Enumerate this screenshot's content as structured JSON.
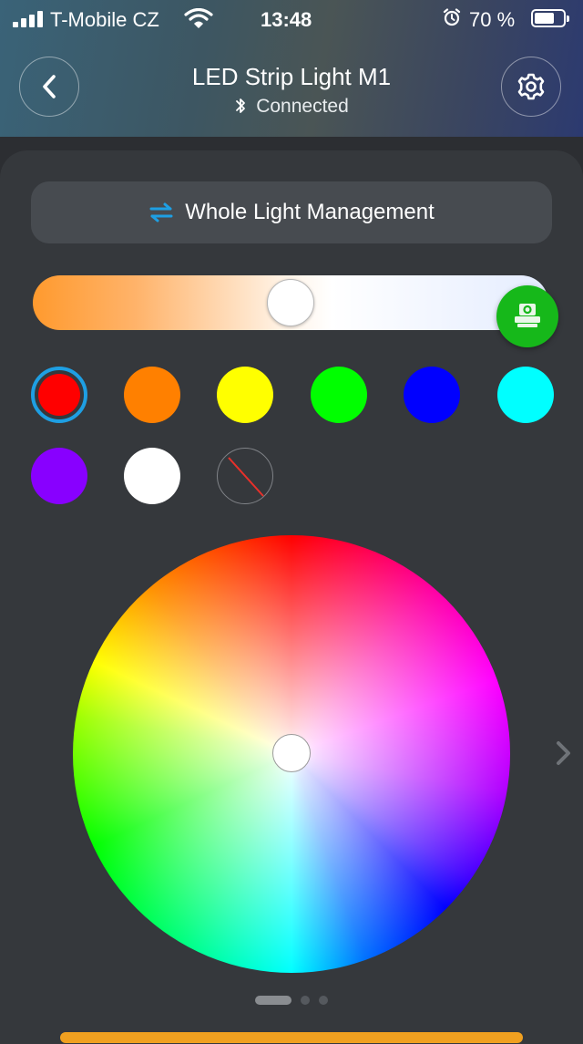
{
  "status_bar": {
    "carrier": "T-Mobile CZ",
    "time": "13:48",
    "battery_percent": "70 %",
    "battery_level": 0.7,
    "icons": [
      "signal-icon",
      "wifi-icon",
      "alarm-icon",
      "battery-icon"
    ]
  },
  "header": {
    "title": "LED Strip Light M1",
    "connection_status": "Connected",
    "icons": [
      "chevron-left-icon",
      "bluetooth-icon",
      "gear-icon"
    ]
  },
  "mode_button": {
    "label": "Whole Light Management",
    "icon": "swap-arrows-icon",
    "accent": "#1e9fe3"
  },
  "color_temperature": {
    "value": 0.5,
    "warm_color": "#ff9a2e",
    "cool_color": "#e4ecff"
  },
  "scene_button": {
    "icon": "scene-icon",
    "color": "#16b81a"
  },
  "swatches": [
    {
      "color": "#ff0000",
      "selected": true
    },
    {
      "color": "#ff8000",
      "selected": false
    },
    {
      "color": "#ffff00",
      "selected": false
    },
    {
      "color": "#00ff00",
      "selected": false
    },
    {
      "color": "#0000ff",
      "selected": false
    },
    {
      "color": "#00ffff",
      "selected": false
    },
    {
      "color": "#8800ff",
      "selected": false
    },
    {
      "color": "#ffffff",
      "selected": false
    },
    {
      "color": "none",
      "selected": false,
      "type": "off"
    }
  ],
  "color_wheel": {
    "selected_color": "#ffffff"
  },
  "pager": {
    "pages": 3,
    "current": 1
  }
}
